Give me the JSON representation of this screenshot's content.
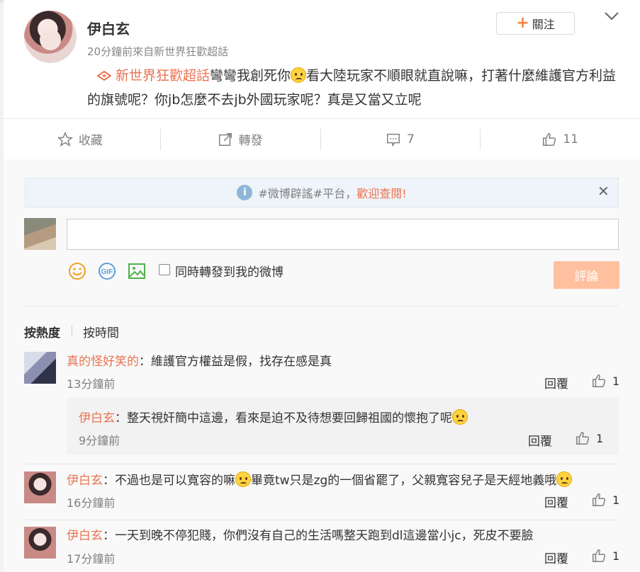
{
  "post": {
    "author": "伊白玄",
    "meta": "20分鐘前來自新世界狂歡超話",
    "follow_label": "關注",
    "supertopic": "新世界狂歡超話",
    "text_1": "彎彎我創死你",
    "text_2": "看大陸玩家不順眼就直說嘛，打著什麼維護官方利益的旗號呢？你jb怎麼不去jb外國玩家呢？真是又當又立呢"
  },
  "actions": {
    "favorite": "收藏",
    "repost": "轉發",
    "comment_count": "7",
    "like_count": "11"
  },
  "notice": {
    "text": "#微博辟謠#平台，",
    "welcome": "歡迎查閱!"
  },
  "composer": {
    "input_value": "",
    "repost_label": "同時轉發到我的微博",
    "submit_label": "評論"
  },
  "sort": {
    "hot": "按熱度",
    "time": "按時間"
  },
  "comments": [
    {
      "user": "真的怪好笑的",
      "text": "：維護官方權益是假，找存在感是真",
      "time": "13分鐘前",
      "reply": "回覆",
      "likes": "1"
    },
    {
      "user": "伊白玄",
      "text": "：整天視奸簡中這邊，看來是迫不及待想要回歸祖國的懷抱了呢",
      "time": "9分鐘前",
      "reply": "回覆",
      "likes": "1"
    },
    {
      "user": "伊白玄",
      "text_1": "：不過也是可以寬容的嘛",
      "text_2": "畢竟tw只是zg的一個省罷了，父親寬容兒子是天經地義哦",
      "time": "16分鐘前",
      "reply": "回覆",
      "likes": "1"
    },
    {
      "user": "伊白玄",
      "text": "：一天到晚不停犯賤，你們沒有自己的生活嗎整天跑到dl這邊當小jc，死皮不要臉",
      "time": "17分鐘前",
      "reply": "回覆",
      "likes": "1"
    }
  ],
  "colors": {
    "accent": "#eb7350",
    "follow_plus": "#ff8140",
    "submit_disabled": "#ffc09f"
  }
}
